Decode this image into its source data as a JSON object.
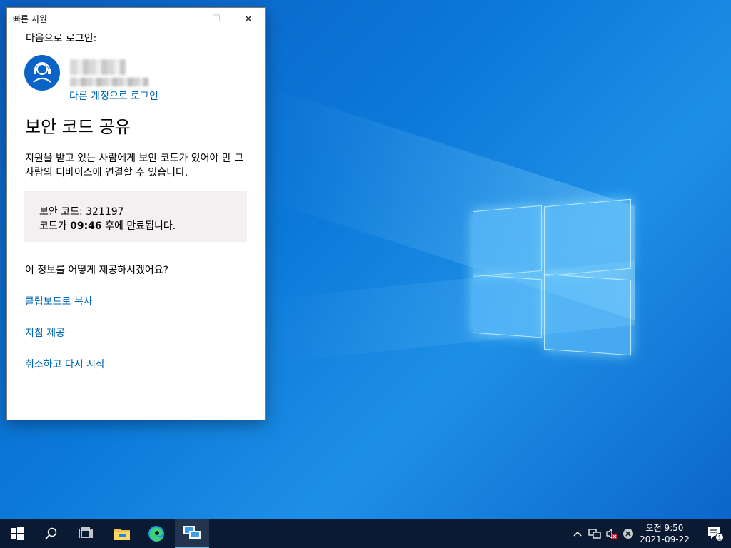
{
  "window": {
    "title": "빠른 지원",
    "minimize_glyph": "—",
    "maximize_glyph": "☐",
    "close_glyph": "✕"
  },
  "login": {
    "label": "다음으로 로그인:",
    "switch_account": "다른 계정으로 로그인"
  },
  "main": {
    "heading": "보안 코드 공유",
    "description": "지원을 받고 있는 사람에게 보안 코드가 있어야 만 그 사람의 디바이스에 연결할 수 있습니다.",
    "code_label": "보안 코드: 321197",
    "expiry_prefix": "코드가 ",
    "expiry_time": "09:46",
    "expiry_suffix": " 후에 만료됩니다.",
    "question": "이 정보를 어떻게 제공하시겠어요?",
    "actions": [
      "클립보드로 복사",
      "지침 제공",
      "취소하고 다시 시작"
    ]
  },
  "taskbar": {
    "clock_time": "오전 9:50",
    "clock_date": "2021-09-22",
    "notification_count": "1",
    "icons": [
      "windows-start-icon",
      "search-icon",
      "task-view-icon",
      "file-explorer-icon",
      "edge-icon",
      "quick-assist-icon"
    ],
    "tray_icons": [
      "chevron-up-icon",
      "network-icon",
      "volume-muted-icon",
      "error-icon"
    ]
  },
  "colors": {
    "link": "#0067b8",
    "avatar": "#0a64c8",
    "taskbar": "#0b1a33",
    "code_box": "#f4f0f2"
  }
}
